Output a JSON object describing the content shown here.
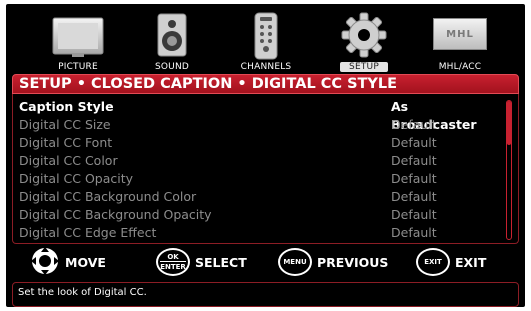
{
  "tabs": [
    {
      "label": "PICTURE",
      "icon": "picture-icon",
      "active": false
    },
    {
      "label": "SOUND",
      "icon": "speaker-icon",
      "active": false
    },
    {
      "label": "CHANNELS",
      "icon": "remote-icon",
      "active": false
    },
    {
      "label": "SETUP",
      "icon": "gear-icon",
      "active": true
    },
    {
      "label": "MHL/ACC",
      "icon": "mhl-logo-icon",
      "active": false
    }
  ],
  "mhl_logo_text": "MHL",
  "header": {
    "title": "SETUP • CLOSED CAPTION • DIGITAL CC STYLE"
  },
  "menu": {
    "items": [
      {
        "name": "Caption Style",
        "value": "As Broadcaster",
        "selected": true
      },
      {
        "name": "Digital CC Size",
        "value": "Default",
        "selected": false
      },
      {
        "name": "Digital CC Font",
        "value": "Default",
        "selected": false
      },
      {
        "name": "Digital CC Color",
        "value": "Default",
        "selected": false
      },
      {
        "name": "Digital CC Opacity",
        "value": "Default",
        "selected": false
      },
      {
        "name": "Digital CC Background Color",
        "value": "Default",
        "selected": false
      },
      {
        "name": "Digital CC Background Opacity",
        "value": "Default",
        "selected": false
      },
      {
        "name": "Digital CC Edge Effect",
        "value": "Default",
        "selected": false
      }
    ]
  },
  "hints": {
    "move": {
      "label": "MOVE"
    },
    "select": {
      "label": "SELECT",
      "key_line1": "OK",
      "key_line2": "ENTER"
    },
    "previous": {
      "label": "PREVIOUS",
      "key": "MENU"
    },
    "exit": {
      "label": "EXIT",
      "key": "EXIT"
    }
  },
  "help": {
    "text": "Set the look of Digital CC."
  },
  "colors": {
    "accent": "#c8202f",
    "background": "#000000",
    "dim_text": "#8d8d8d"
  }
}
